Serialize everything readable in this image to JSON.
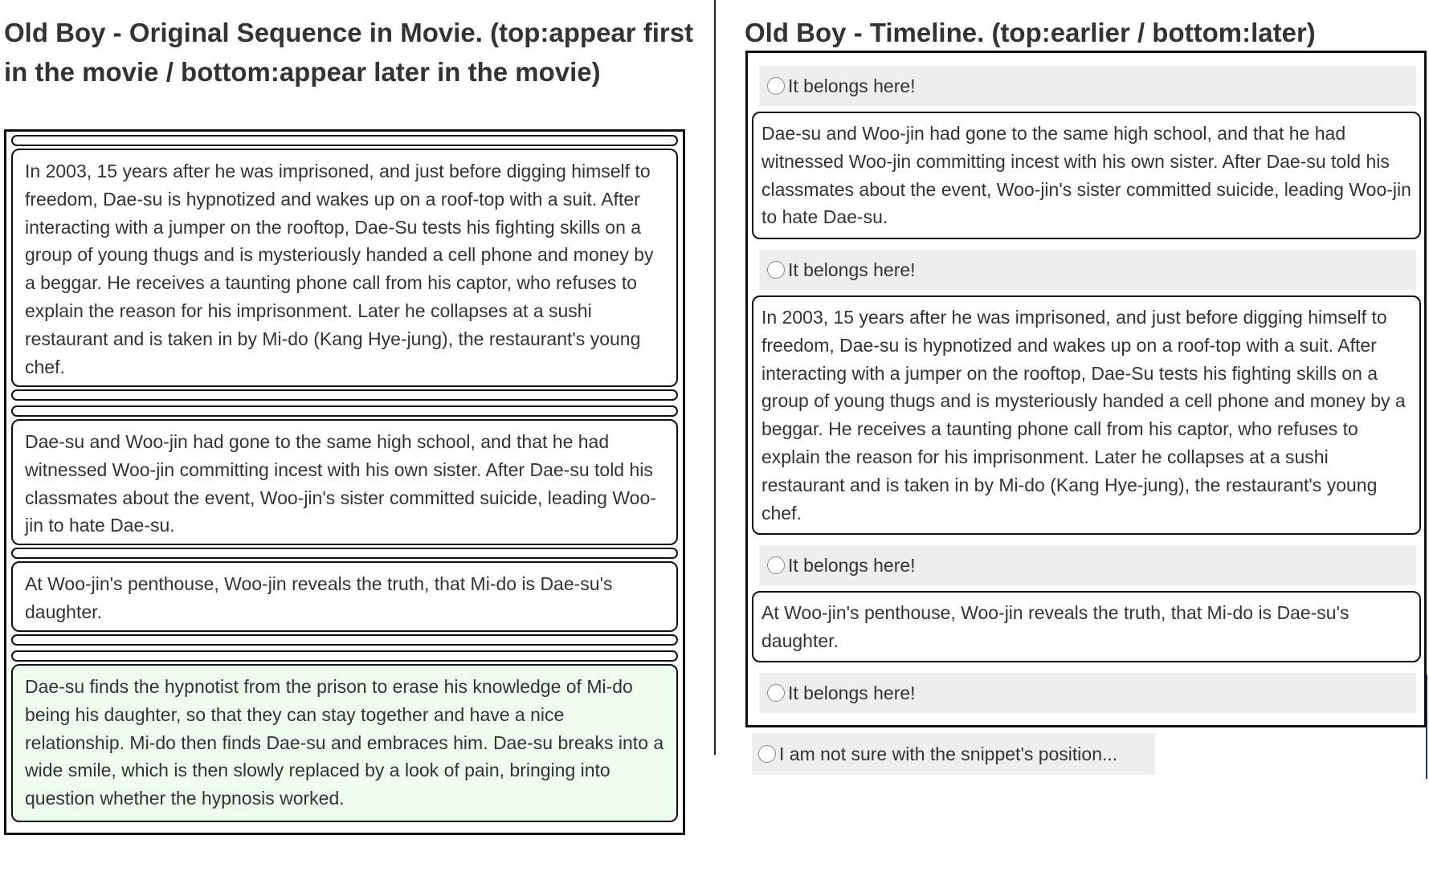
{
  "left_panel": {
    "heading": "Old Boy - Original Sequence in Movie. (top:appear first in the movie / bottom:appear later in the movie)",
    "snippets": [
      "In 2003, 15 years after he was imprisoned, and just before digging himself to freedom, Dae-su is hypnotized and wakes up on a roof-top with a suit. After interacting with a jumper on the rooftop, Dae-Su tests his fighting skills on a group of young thugs and is mysteriously handed a cell phone and money by a beggar. He receives a taunting phone call from his captor, who refuses to explain the reason for his imprisonment. Later he collapses at a sushi restaurant and is taken in by Mi-do (Kang Hye-jung), the restaurant's young chef.",
      "Dae-su and Woo-jin had gone to the same high school, and that he had witnessed Woo-jin committing incest with his own sister. After Dae-su told his classmates about the event, Woo-jin's sister committed suicide, leading Woo-jin to hate Dae-su.",
      "At Woo-jin's penthouse, Woo-jin reveals the truth, that Mi-do is Dae-su's daughter.",
      "Dae-su finds the hypnotist from the prison to erase his knowledge of Mi-do being his daughter, so that they can stay together and have a nice relationship. Mi-do then finds Dae-su and embraces him. Dae-su breaks into a wide smile, which is then slowly replaced by a look of pain, bringing into question whether the hypnosis worked."
    ]
  },
  "right_panel": {
    "heading": "Old Boy - Timeline. (top:earlier / bottom:later)",
    "drop_label": "It belongs here!",
    "snippets": [
      "Dae-su and Woo-jin had gone to the same high school, and that he had witnessed Woo-jin committing incest with his own sister. After Dae-su told his classmates about the event, Woo-jin's sister committed suicide, leading Woo-jin to hate Dae-su.",
      "In 2003, 15 years after he was imprisoned, and just before digging himself to freedom, Dae-su is hypnotized and wakes up on a roof-top with a suit. After interacting with a jumper on the rooftop, Dae-Su tests his fighting skills on a group of young thugs and is mysteriously handed a cell phone and money by a beggar. He receives a taunting phone call from his captor, who refuses to explain the reason for his imprisonment. Later he collapses at a sushi restaurant and is taken in by Mi-do (Kang Hye-jung), the restaurant's young chef.",
      "At Woo-jin's penthouse, Woo-jin reveals the truth, that Mi-do is Dae-su's daughter."
    ],
    "unsure_label": "I am not sure with the snippet's position..."
  },
  "colors": {
    "final_snippet_bg": "#ecfdee",
    "drop_row_bg": "#eeeeee",
    "border": "#111111"
  }
}
